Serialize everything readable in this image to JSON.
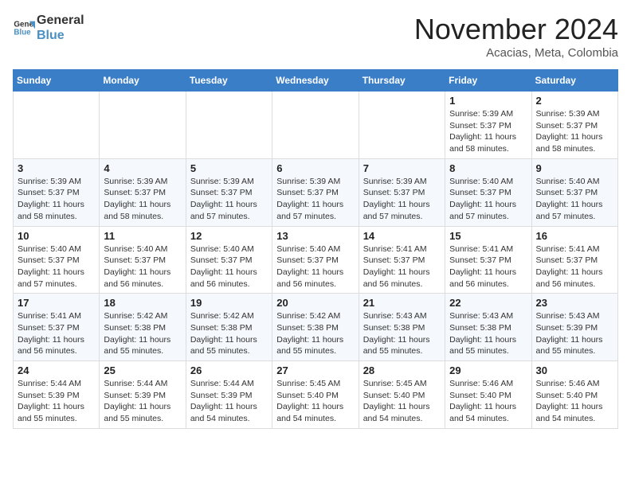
{
  "header": {
    "logo_line1": "General",
    "logo_line2": "Blue",
    "month": "November 2024",
    "location": "Acacias, Meta, Colombia"
  },
  "weekdays": [
    "Sunday",
    "Monday",
    "Tuesday",
    "Wednesday",
    "Thursday",
    "Friday",
    "Saturday"
  ],
  "weeks": [
    [
      {
        "day": "",
        "info": ""
      },
      {
        "day": "",
        "info": ""
      },
      {
        "day": "",
        "info": ""
      },
      {
        "day": "",
        "info": ""
      },
      {
        "day": "",
        "info": ""
      },
      {
        "day": "1",
        "info": "Sunrise: 5:39 AM\nSunset: 5:37 PM\nDaylight: 11 hours\nand 58 minutes."
      },
      {
        "day": "2",
        "info": "Sunrise: 5:39 AM\nSunset: 5:37 PM\nDaylight: 11 hours\nand 58 minutes."
      }
    ],
    [
      {
        "day": "3",
        "info": "Sunrise: 5:39 AM\nSunset: 5:37 PM\nDaylight: 11 hours\nand 58 minutes."
      },
      {
        "day": "4",
        "info": "Sunrise: 5:39 AM\nSunset: 5:37 PM\nDaylight: 11 hours\nand 58 minutes."
      },
      {
        "day": "5",
        "info": "Sunrise: 5:39 AM\nSunset: 5:37 PM\nDaylight: 11 hours\nand 57 minutes."
      },
      {
        "day": "6",
        "info": "Sunrise: 5:39 AM\nSunset: 5:37 PM\nDaylight: 11 hours\nand 57 minutes."
      },
      {
        "day": "7",
        "info": "Sunrise: 5:39 AM\nSunset: 5:37 PM\nDaylight: 11 hours\nand 57 minutes."
      },
      {
        "day": "8",
        "info": "Sunrise: 5:40 AM\nSunset: 5:37 PM\nDaylight: 11 hours\nand 57 minutes."
      },
      {
        "day": "9",
        "info": "Sunrise: 5:40 AM\nSunset: 5:37 PM\nDaylight: 11 hours\nand 57 minutes."
      }
    ],
    [
      {
        "day": "10",
        "info": "Sunrise: 5:40 AM\nSunset: 5:37 PM\nDaylight: 11 hours\nand 57 minutes."
      },
      {
        "day": "11",
        "info": "Sunrise: 5:40 AM\nSunset: 5:37 PM\nDaylight: 11 hours\nand 56 minutes."
      },
      {
        "day": "12",
        "info": "Sunrise: 5:40 AM\nSunset: 5:37 PM\nDaylight: 11 hours\nand 56 minutes."
      },
      {
        "day": "13",
        "info": "Sunrise: 5:40 AM\nSunset: 5:37 PM\nDaylight: 11 hours\nand 56 minutes."
      },
      {
        "day": "14",
        "info": "Sunrise: 5:41 AM\nSunset: 5:37 PM\nDaylight: 11 hours\nand 56 minutes."
      },
      {
        "day": "15",
        "info": "Sunrise: 5:41 AM\nSunset: 5:37 PM\nDaylight: 11 hours\nand 56 minutes."
      },
      {
        "day": "16",
        "info": "Sunrise: 5:41 AM\nSunset: 5:37 PM\nDaylight: 11 hours\nand 56 minutes."
      }
    ],
    [
      {
        "day": "17",
        "info": "Sunrise: 5:41 AM\nSunset: 5:37 PM\nDaylight: 11 hours\nand 56 minutes."
      },
      {
        "day": "18",
        "info": "Sunrise: 5:42 AM\nSunset: 5:38 PM\nDaylight: 11 hours\nand 55 minutes."
      },
      {
        "day": "19",
        "info": "Sunrise: 5:42 AM\nSunset: 5:38 PM\nDaylight: 11 hours\nand 55 minutes."
      },
      {
        "day": "20",
        "info": "Sunrise: 5:42 AM\nSunset: 5:38 PM\nDaylight: 11 hours\nand 55 minutes."
      },
      {
        "day": "21",
        "info": "Sunrise: 5:43 AM\nSunset: 5:38 PM\nDaylight: 11 hours\nand 55 minutes."
      },
      {
        "day": "22",
        "info": "Sunrise: 5:43 AM\nSunset: 5:38 PM\nDaylight: 11 hours\nand 55 minutes."
      },
      {
        "day": "23",
        "info": "Sunrise: 5:43 AM\nSunset: 5:39 PM\nDaylight: 11 hours\nand 55 minutes."
      }
    ],
    [
      {
        "day": "24",
        "info": "Sunrise: 5:44 AM\nSunset: 5:39 PM\nDaylight: 11 hours\nand 55 minutes."
      },
      {
        "day": "25",
        "info": "Sunrise: 5:44 AM\nSunset: 5:39 PM\nDaylight: 11 hours\nand 55 minutes."
      },
      {
        "day": "26",
        "info": "Sunrise: 5:44 AM\nSunset: 5:39 PM\nDaylight: 11 hours\nand 54 minutes."
      },
      {
        "day": "27",
        "info": "Sunrise: 5:45 AM\nSunset: 5:40 PM\nDaylight: 11 hours\nand 54 minutes."
      },
      {
        "day": "28",
        "info": "Sunrise: 5:45 AM\nSunset: 5:40 PM\nDaylight: 11 hours\nand 54 minutes."
      },
      {
        "day": "29",
        "info": "Sunrise: 5:46 AM\nSunset: 5:40 PM\nDaylight: 11 hours\nand 54 minutes."
      },
      {
        "day": "30",
        "info": "Sunrise: 5:46 AM\nSunset: 5:40 PM\nDaylight: 11 hours\nand 54 minutes."
      }
    ]
  ]
}
